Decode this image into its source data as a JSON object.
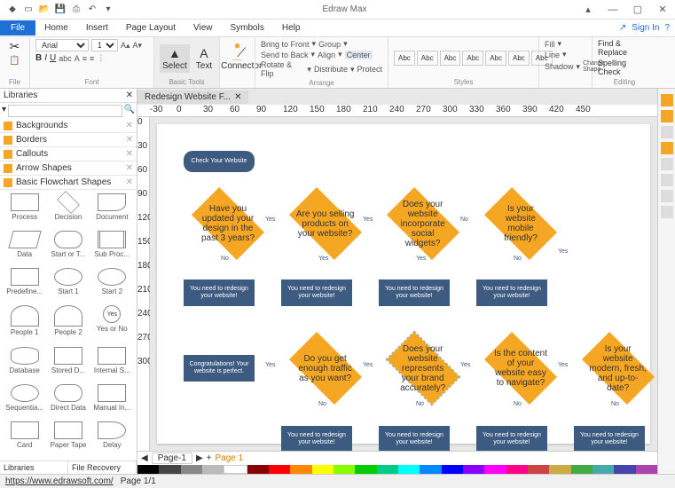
{
  "app": {
    "title": "Edraw Max"
  },
  "qat": [
    "new",
    "open",
    "save",
    "undo",
    "redo",
    "print"
  ],
  "win": {
    "min": "—",
    "help": "?",
    "max": "▢",
    "close": "✕"
  },
  "menu": {
    "file": "File",
    "items": [
      "Home",
      "Insert",
      "Page Layout",
      "View",
      "Symbols",
      "Help"
    ],
    "share": "Share",
    "signin": "Sign In"
  },
  "ribbon": {
    "font_name": "Arial",
    "font_size": "10",
    "groups": {
      "file": "File",
      "font": "Font",
      "basic": "Basic Tools",
      "arrange": "Arrange",
      "styles": "Styles",
      "editing": "Editing"
    },
    "basic": {
      "select": "Select",
      "text": "Text",
      "connector": "Connector"
    },
    "arrange": {
      "bring": "Bring to Front",
      "send": "Send to Back",
      "rotate": "Rotate & Flip",
      "group": "Group",
      "align": "Align",
      "distribute": "Distribute",
      "center": "Center",
      "protect": "Protect"
    },
    "styles": [
      "Abc",
      "Abc",
      "Abc",
      "Abc",
      "Abc",
      "Abc",
      "Abc"
    ],
    "style_opts": {
      "fill": "Fill",
      "line": "Line",
      "shadow": "Shadow",
      "change": "Change Shape"
    },
    "editing": {
      "find": "Find & Replace",
      "spell": "Spelling Check"
    }
  },
  "libraries": {
    "title": "Libraries",
    "search_placeholder": "",
    "cats": [
      "Backgrounds",
      "Borders",
      "Callouts",
      "Arrow Shapes",
      "Basic Flowchart Shapes"
    ],
    "shapes": [
      "Process",
      "Decision",
      "Document",
      "Data",
      "Start or T...",
      "Sub Proc...",
      "Predefine...",
      "Start 1",
      "Start 2",
      "People 1",
      "People 2",
      "Yes or No",
      "Database",
      "Stored D...",
      "Internal S...",
      "Sequentia...",
      "Direct Data",
      "Manual In...",
      "Card",
      "Paper Tape",
      "Delay"
    ],
    "tabs": {
      "lib": "Libraries",
      "rec": "File Recovery"
    }
  },
  "doc": {
    "tab": "Redesign Website F..."
  },
  "ruler_h": [
    "-30",
    "0",
    "30",
    "60",
    "90",
    "120",
    "150",
    "180",
    "210",
    "240",
    "270",
    "300",
    "330",
    "360",
    "390",
    "420",
    "450"
  ],
  "ruler_v": [
    "0",
    "30",
    "60",
    "90",
    "120",
    "150",
    "180",
    "210",
    "240",
    "270",
    "300"
  ],
  "flow": {
    "start": "Check Your Website",
    "d1": "Have you updated your design in the past 3 years?",
    "d2": "Are you selling products on your website?",
    "d3": "Does your website incorporate social widgets?",
    "d4": "Is your website mobile friendly?",
    "d5": "Do you get enough traffic as you want?",
    "d6": "Does your website represents your brand accurately?",
    "d7": "Is the content of your website easy to navigate?",
    "d8": "Is your website modern, fresh, and up-to-date?",
    "redesign": "You need to redesign your website!",
    "perfect": "Congratulations! Your website is perfect.",
    "yes": "Yes",
    "no": "No"
  },
  "pagetabs": {
    "p1": "Page-1",
    "p2": "Page 1"
  },
  "status": {
    "url": "https://www.edrawsoft.com/",
    "page": "Page 1/1"
  },
  "colors": [
    "#000",
    "#444",
    "#888",
    "#ccc",
    "#fff",
    "#900",
    "#f00",
    "#f80",
    "#ff0",
    "#8f0",
    "#0f0",
    "#0f8",
    "#0ff",
    "#08f",
    "#00f",
    "#80f",
    "#f0f",
    "#f08",
    "#800",
    "#880",
    "#080",
    "#088",
    "#008",
    "#808"
  ]
}
